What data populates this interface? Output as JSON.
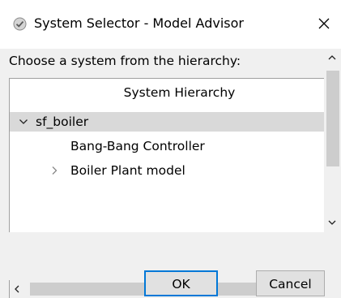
{
  "window": {
    "title": "System Selector - Model Advisor",
    "app_icon": "checkmark-badge-icon",
    "close_glyph": "✕"
  },
  "prompt": "Choose a system from the hierarchy:",
  "tree": {
    "header": "System Hierarchy",
    "rows": [
      {
        "label": "sf_boiler",
        "expanded": true,
        "selected": true,
        "level": 0
      },
      {
        "label": "Bang-Bang Controller",
        "expanded": null,
        "selected": false,
        "level": 1
      },
      {
        "label": "Boiler Plant model",
        "expanded": false,
        "selected": false,
        "level": 1
      }
    ]
  },
  "buttons": {
    "ok_label": "OK",
    "cancel_label": "Cancel"
  },
  "colors": {
    "accent": "#0078d7",
    "selection": "#d9d9d9",
    "dialog_bg": "#f0f0f0"
  }
}
